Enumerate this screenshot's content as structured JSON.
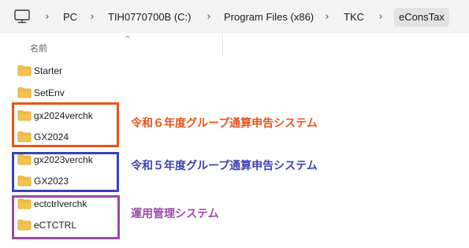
{
  "breadcrumb": {
    "items": [
      "PC",
      "TIH0770700B (C:)",
      "Program Files (x86)",
      "TKC",
      "eConsTax"
    ],
    "separator": "›"
  },
  "list": {
    "column_header": "名前",
    "sort_indicator": "^",
    "items": [
      "Starter",
      "SetEnv",
      "gx2024verchk",
      "GX2024",
      "gx2023verchk",
      "GX2023",
      "ectctrlverchk",
      "eCTCTRL"
    ]
  },
  "annotations": {
    "orange": "令和６年度グループ通算申告システム",
    "blue": "令和５年度グループ通算申告システム",
    "purple": "運用管理システム"
  },
  "colors": {
    "orange": "#e8541a",
    "blue": "#3b43b0",
    "purple": "#9b4aa7",
    "folder": "#f3c34d"
  },
  "icons": {
    "pc": "computer-monitor-icon",
    "folder": "folder-icon"
  }
}
